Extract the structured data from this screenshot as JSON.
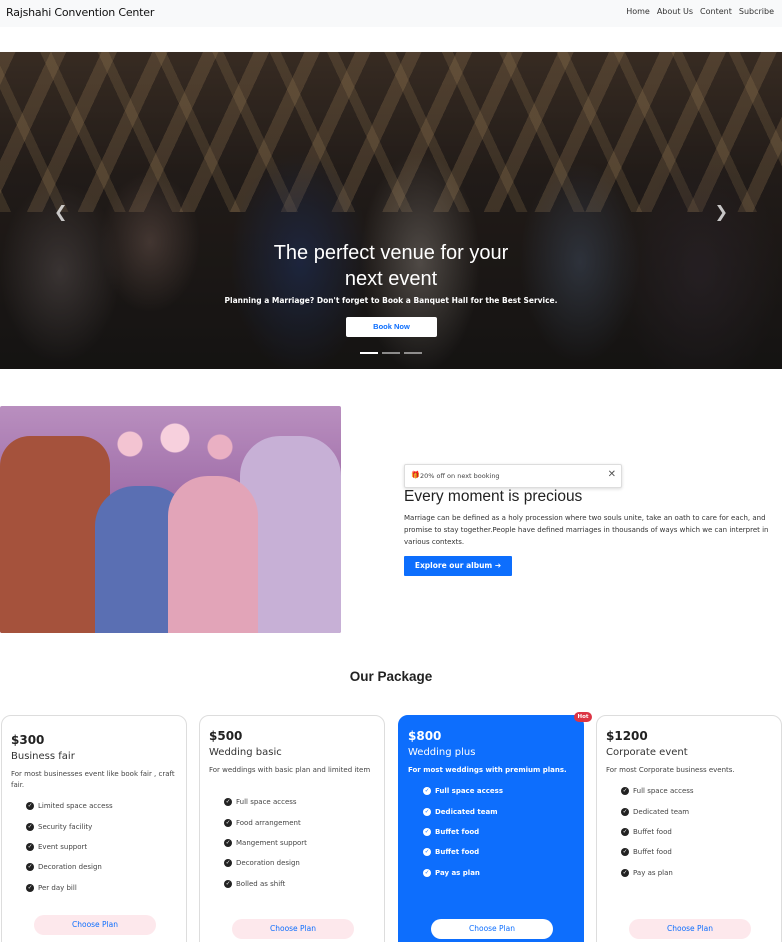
{
  "navbar": {
    "brand": "Rajshahi Convention Center",
    "links": [
      "Home",
      "About Us",
      "Content",
      "Subcribe"
    ]
  },
  "hero": {
    "title_line1": "The perfect venue for your",
    "title_line2": "next event",
    "subtitle": "Planning a Marriage? Don't forget to Book a Banquet Hall for the Best Service.",
    "button": "Book Now",
    "prev_icon": "chevron-left-icon",
    "next_icon": "chevron-right-icon"
  },
  "moment": {
    "toast_icon": "gift-icon",
    "toast_text": "20% off on next booking",
    "title": "Every moment is precious",
    "text": "Marriage can be defined as a holy procession where two souls unite, take an oath to care for each, and promise to stay together.People have defined marriages in thousands of ways which we can interpret in various contexts.",
    "button": "Explore our album"
  },
  "packages": {
    "heading": "Our Package",
    "badge": "Hot",
    "choose_label": "Choose Plan",
    "items": [
      {
        "price": "$300",
        "name": "Business fair",
        "desc": "For most businesses event like book fair , craft fair.",
        "features": [
          "Limited space access",
          "Security facility",
          "Event support",
          "Decoration design",
          "Per day bill"
        ]
      },
      {
        "price": "$500",
        "name": "Wedding basic",
        "desc": "For weddings with basic plan and limited item",
        "features": [
          "Full space access",
          "Food arrangement",
          "Mangement support",
          "Decoration design",
          "Bolled as shift"
        ]
      },
      {
        "price": "$800",
        "name": "Wedding plus",
        "desc": "For most weddings with premium plans.",
        "features": [
          "Full space access",
          "Dedicated team",
          "Buffet food",
          "Buffet food",
          "Pay as plan"
        ]
      },
      {
        "price": "$1200",
        "name": "Corporate event",
        "desc": "For most Corporate business events.",
        "features": [
          "Full space access",
          "Dedicated team",
          "Buffet food",
          "Buffet food",
          "Pay as plan"
        ]
      }
    ]
  },
  "colors": {
    "primary": "#0d6efd",
    "badge": "#dc3545",
    "choose_bg": "#fde8ec"
  }
}
